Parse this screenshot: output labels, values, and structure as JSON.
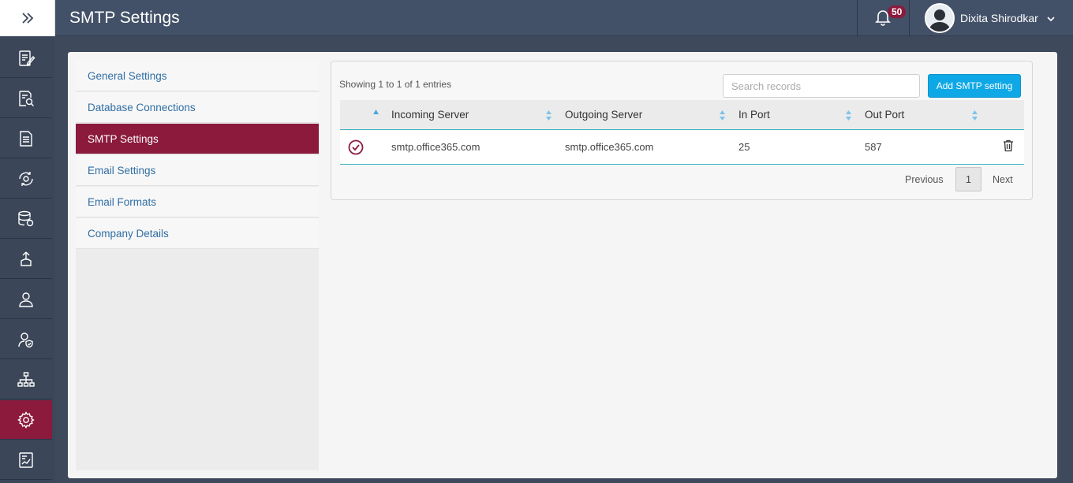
{
  "header": {
    "title": "SMTP Settings",
    "notification_count": "50",
    "user_name": "Dixita Shirodkar"
  },
  "rail": {
    "toggle_icon": "double-chevron-right-icon",
    "items": [
      {
        "icon": "edit-document-icon"
      },
      {
        "icon": "search-document-icon"
      },
      {
        "icon": "document-icon"
      },
      {
        "icon": "sync-gear-icon"
      },
      {
        "icon": "database-sync-icon"
      },
      {
        "icon": "upload-hand-icon"
      },
      {
        "icon": "user-icon"
      },
      {
        "icon": "user-shield-icon"
      },
      {
        "icon": "hierarchy-icon"
      },
      {
        "icon": "settings-gear-icon",
        "active": true
      },
      {
        "icon": "report-chart-icon"
      }
    ]
  },
  "subnav": {
    "items": [
      {
        "label": "General Settings"
      },
      {
        "label": "Database Connections"
      },
      {
        "label": "SMTP Settings",
        "active": true
      },
      {
        "label": "Email Settings"
      },
      {
        "label": "Email Formats"
      },
      {
        "label": "Company Details"
      }
    ]
  },
  "table": {
    "info": "Showing 1 to 1 of 1 entries",
    "search_placeholder": "Search records",
    "add_label": "Add SMTP setting",
    "columns": [
      "Incoming Server",
      "Outgoing Server",
      "In Port",
      "Out Port"
    ],
    "rows": [
      {
        "incoming": "smtp.office365.com",
        "outgoing": "smtp.office365.com",
        "in_port": "25",
        "out_port": "587",
        "selected": true
      }
    ]
  },
  "pagination": {
    "previous": "Previous",
    "page": "1",
    "next": "Next"
  },
  "colors": {
    "accent": "#8b1a3d",
    "primary_button": "#0fa8e6",
    "header_bg": "#435168",
    "rail_bg": "#3b4658",
    "table_border": "#3bb4bf"
  }
}
